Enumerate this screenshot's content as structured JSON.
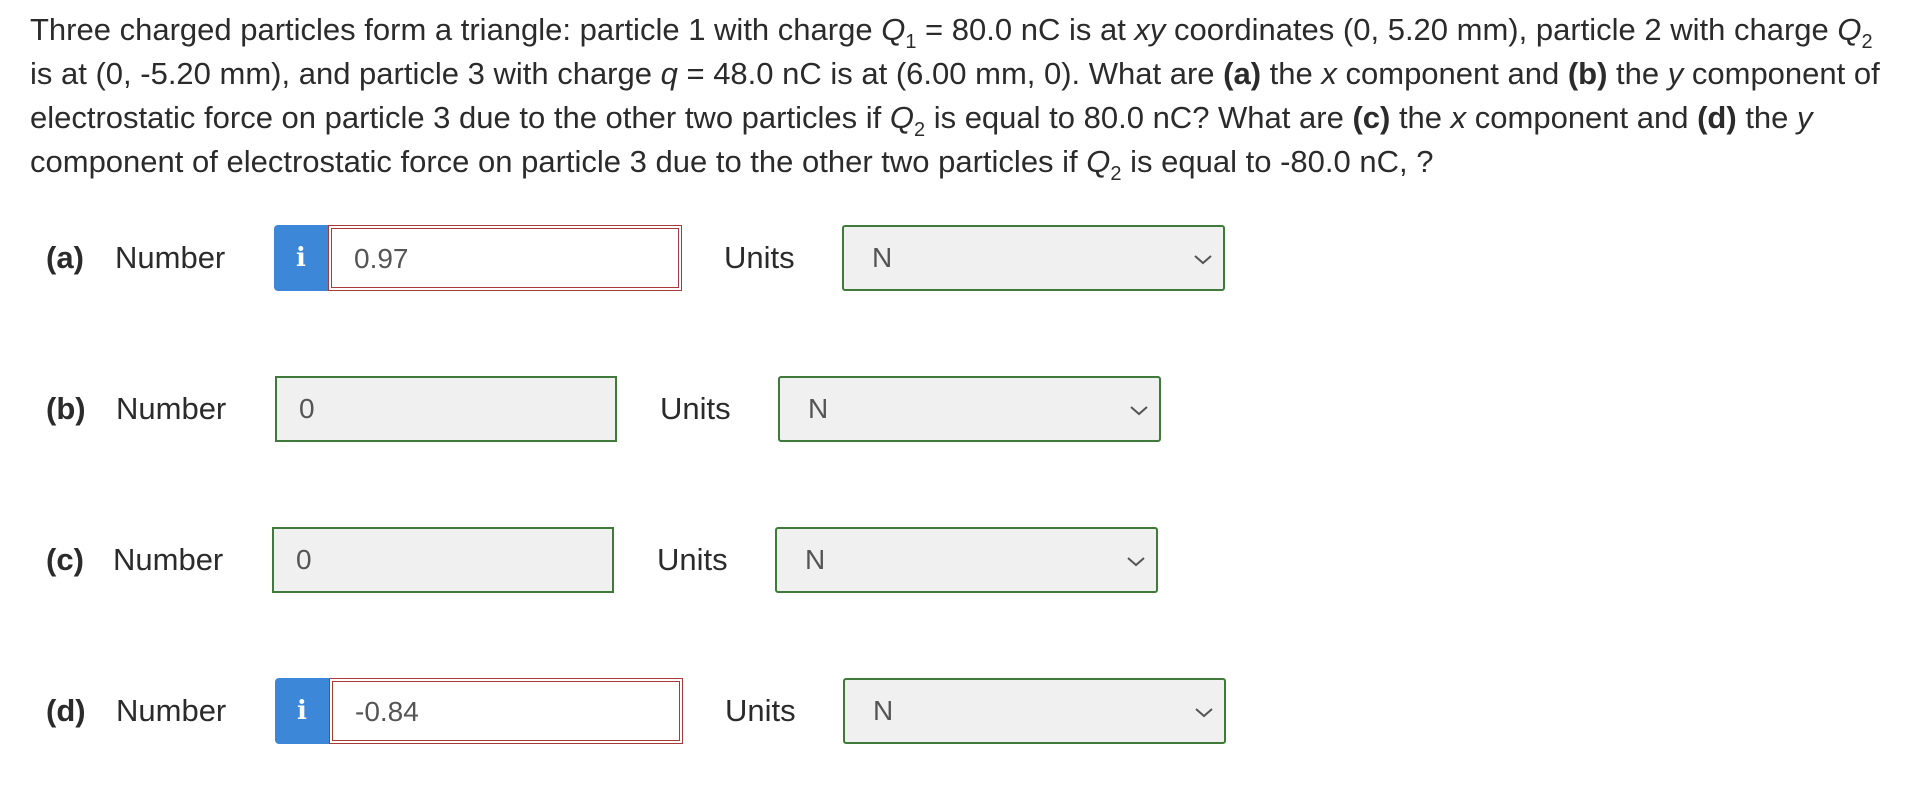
{
  "question": {
    "s1": "Three charged particles form a triangle: particle 1 with charge ",
    "q1": "Q",
    "q1sub": "1",
    "s2": " = 80.0 nC is at ",
    "xy": "xy",
    "s3": " coordinates (0, 5.20 mm), particle 2 with charge ",
    "q2": "Q",
    "q2sub": "2",
    "s4": " is at (0, -5.20 mm), and particle 3 with charge ",
    "qvar": "q",
    "s5": " = 48.0 nC is at (6.00 mm, 0). What are ",
    "pa": "(a)",
    "s6": " the ",
    "xa": "x",
    "s7": " component and ",
    "pb": "(b)",
    "s8": " the ",
    "yb": "y",
    "s9": " component of electrostatic force on particle 3 due to the other two particles if ",
    "q2b": "Q",
    "q2bsub": "2",
    "s10": " is equal to 80.0 nC? What are ",
    "pc": "(c)",
    "s11": " the ",
    "xc": "x",
    "s12": " component and ",
    "pd": "(d)",
    "s13": " the ",
    "yd": "y",
    "s14": " component of electrostatic force on particle 3 due to the other two particles if ",
    "q2c": "Q",
    "q2csub": "2",
    "s15": " is equal to -80.0 nC, ?"
  },
  "answers": [
    {
      "part": "(a)",
      "number_label": "Number",
      "value": "0.97",
      "units_label": "Units",
      "unit": "N",
      "info": "i"
    },
    {
      "part": "(b)",
      "number_label": "Number",
      "value": "0",
      "units_label": "Units",
      "unit": "N"
    },
    {
      "part": "(c)",
      "number_label": "Number",
      "value": "0",
      "units_label": "Units",
      "unit": "N"
    },
    {
      "part": "(d)",
      "number_label": "Number",
      "value": "-0.84",
      "units_label": "Units",
      "unit": "N",
      "info": "i"
    }
  ],
  "colors": {
    "info_blue": "#3d87d8",
    "wrong_border": "#a83a3a",
    "field_border_green": "#3f7a3a",
    "field_bg": "#f0f0f0"
  }
}
